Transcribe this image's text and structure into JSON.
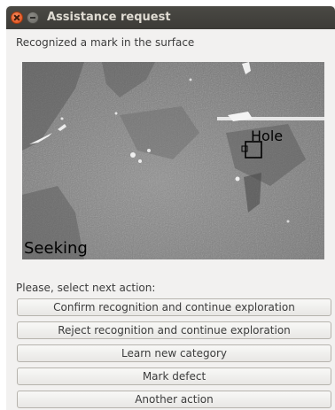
{
  "window": {
    "title": "Assistance request"
  },
  "message": "Recognized a mark in the surface",
  "camera": {
    "detection_label": "Hole",
    "status_label": "Seeking"
  },
  "prompt": "Please, select next action:",
  "actions": [
    {
      "label": "Confirm recognition and continue exploration"
    },
    {
      "label": "Reject recognition and continue exploration"
    },
    {
      "label": "Learn new category"
    },
    {
      "label": "Mark defect"
    },
    {
      "label": "Another action"
    }
  ],
  "icons": {
    "close": "close-icon",
    "minimize": "minimize-icon"
  },
  "colors": {
    "titlebar": "#3c3b37",
    "close_button": "#df4a16",
    "window_bg": "#f2f1f0"
  }
}
